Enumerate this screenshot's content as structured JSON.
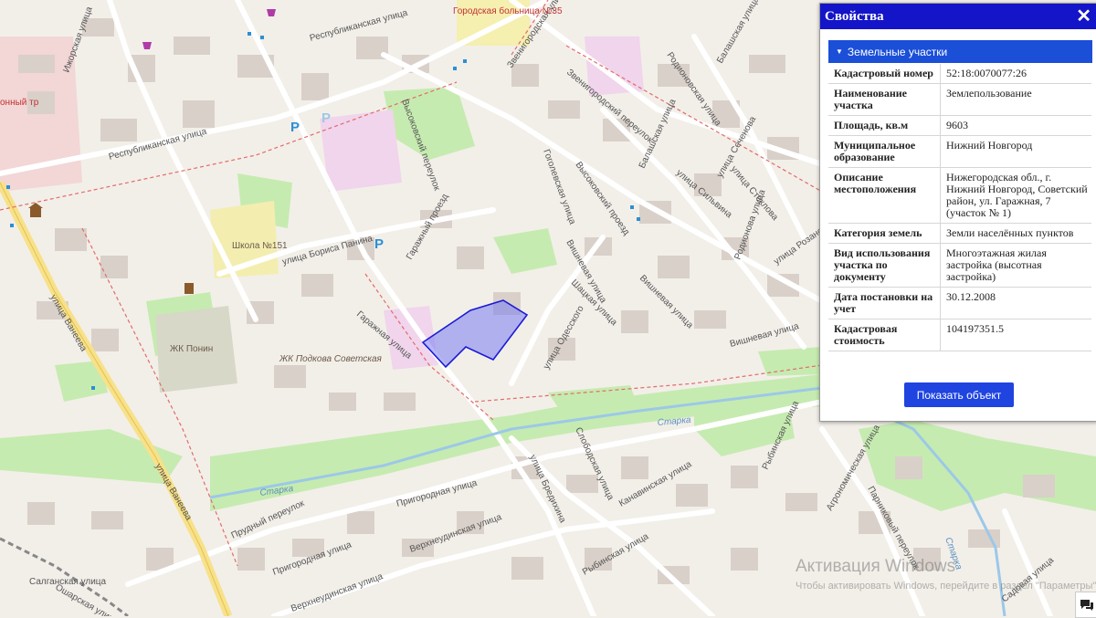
{
  "map": {
    "street_labels": [
      "Республиканская улица",
      "Республиканская улица",
      "Ижорская улица",
      "Звенигородская улица",
      "Звенигородский переулок",
      "Родионовская улица",
      "Балашская улица",
      "Высоковский переулок",
      "Гоголевская улица",
      "Высоковский проезд",
      "Балашская улица",
      "улица Сеченова",
      "улица Стеклова",
      "улица Сильвина",
      "улица Бориса Панина",
      "Гаражный проезд",
      "Гаражная улица",
      "Вишневая улица",
      "Шацкая улица",
      "улица Одесского",
      "Вишневая улица",
      "Родионова улица",
      "Вишневая улица",
      "улица Розанова",
      "улица Ванеева",
      "улица Ванеева",
      "Прудный переулок",
      "Пригородная улица",
      "Пригородная улица",
      "Верхнеудинская улица",
      "Верхнеудинская улица",
      "Рыбинская улица",
      "Канавинская улица",
      "Слободская улица",
      "улица Бредихина",
      "Ошарская улица",
      "Салганская улица",
      "Рыбинская улица",
      "Агрономическая улица",
      "Парниковый переулок",
      "Садовая улица",
      "Старка",
      "Старка",
      "Старка"
    ],
    "place_labels": [
      "Городская больница №35",
      "Школа №151",
      "ЖК Понин",
      "ЖК Подкова Советская",
      "онный тр"
    ],
    "icons": [
      "parking-icon",
      "parking-icon",
      "parking-icon",
      "museum-icon",
      "shop-icon",
      "shop-icon",
      "courthouse-icon"
    ],
    "colors": {
      "parcel_fill": "#7a7cf2",
      "parcel_stroke": "#1a1ad6",
      "park": "#c6ebb0",
      "building": "#d9d0c9",
      "road": "#ffffff",
      "primary_road": "#f7e18a"
    }
  },
  "panel": {
    "title": "Свойства",
    "close_icon": "close-icon",
    "section_label": "Земельные участки",
    "rows": [
      {
        "key": "Кадастровый номер",
        "value": "52:18:0070077:26"
      },
      {
        "key": "Наименование участка",
        "value": "Землепользование"
      },
      {
        "key": "Площадь, кв.м",
        "value": "9603"
      },
      {
        "key": "Муниципальное образование",
        "value": "Нижний Новгород"
      },
      {
        "key": "Описание местоположения",
        "value": "Нижегородская обл., г. Нижний Новгород, Советский район, ул. Гаражная, 7 (участок № 1)"
      },
      {
        "key": "Категория земель",
        "value": "Земли населённых пунктов"
      },
      {
        "key": "Вид использования участка по документу",
        "value": "Многоэтажная жилая застройка (высотная застройка)"
      },
      {
        "key": "Дата постановки на учет",
        "value": "30.12.2008"
      },
      {
        "key": "Кадастровая стоимость",
        "value": "104197351.5"
      }
    ],
    "show_button": "Показать объект"
  },
  "watermark": {
    "title": "Активация Windows",
    "subtitle": "Чтобы активировать Windows, перейдите в раздел \"Параметры\"."
  },
  "chat_icon": "chat-icon"
}
